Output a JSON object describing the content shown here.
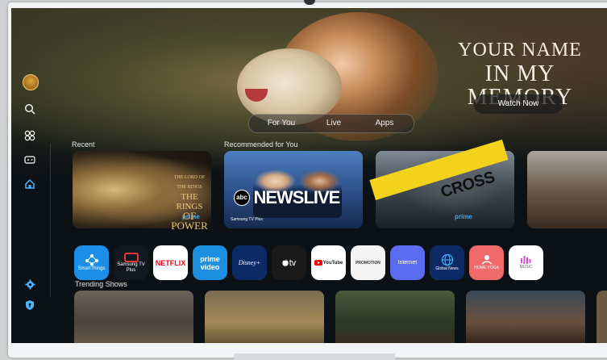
{
  "hero": {
    "title_line1": "YOUR NAME",
    "title_line2": "IN MY MEMORY",
    "watch_label": "Watch Now"
  },
  "tabs": [
    {
      "label": "For You"
    },
    {
      "label": "Live"
    },
    {
      "label": "Apps"
    }
  ],
  "sidebar": {
    "icons": [
      "profile-avatar",
      "search-icon",
      "ambient-icon",
      "game-icon",
      "home-icon",
      "settings-icon",
      "privacy-shield-icon"
    ]
  },
  "sections": {
    "recent": "Recent",
    "recommended": "Recommended for You",
    "trending": "Trending Shows"
  },
  "recent_card": {
    "line1": "THE LORD OF THE RINGS",
    "line2": "THE RINGS",
    "line3": "OF POWER",
    "badge": "prime"
  },
  "recommended": [
    {
      "logo": "abc",
      "title": "NEWSLIVE",
      "badge": "Samsung TV Plus"
    },
    {
      "title": "CROSS",
      "badge": "prime"
    }
  ],
  "apps": [
    {
      "label": "SmartThings",
      "bg": "#1b8fe8"
    },
    {
      "label": "Samsung TV Plus",
      "bg": "#111820"
    },
    {
      "label": "NETFLIX",
      "bg": "#ffffff"
    },
    {
      "label": "prime video",
      "bg": "#1d8fe1"
    },
    {
      "label": "Disney+",
      "bg": "#0b2a66"
    },
    {
      "label": "tv",
      "bg": "#1a1a1a"
    },
    {
      "label": "YouTube",
      "bg": "#ffffff"
    },
    {
      "label": "PROMOTION",
      "bg": "#f4f4f4"
    },
    {
      "label": "Internet",
      "bg": "#5b6cf0"
    },
    {
      "label": "Global News",
      "bg": "#0c2a66"
    },
    {
      "label": "HOME YOGA",
      "bg": "#f06a6a"
    },
    {
      "label": "MUSIC",
      "bg": "#ffffff"
    }
  ]
}
